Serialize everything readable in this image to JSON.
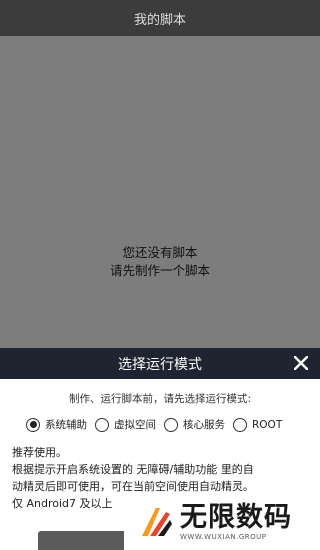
{
  "header": {
    "title": "我的脚本"
  },
  "empty_state": {
    "line1": "您还没有脚本",
    "line2": "请先制作一个脚本"
  },
  "dialog": {
    "title": "选择运行模式",
    "close_icon": "close-icon",
    "prompt": "制作、运行脚本前，请先选择运行模式:",
    "options": [
      {
        "label": "系统辅助",
        "selected": true
      },
      {
        "label": "虚拟空间",
        "selected": false
      },
      {
        "label": "核心服务",
        "selected": false
      },
      {
        "label": "ROOT",
        "selected": false
      }
    ],
    "description": {
      "line1": "推荐使用。",
      "line2": "根据提示开启系统设置的 无障碍/辅助功能 里的自",
      "line3": "动精灵后即可使用，可在当前空间使用自动精灵。",
      "line4": "仅 Android7 及以上"
    }
  },
  "watermark": {
    "brand_cn": "无限数码",
    "brand_en": "WWW.WUXIAN.GROUP",
    "colors": {
      "orange": "#f39a1f",
      "red": "#e8452c",
      "dark": "#1a1a1a"
    }
  }
}
